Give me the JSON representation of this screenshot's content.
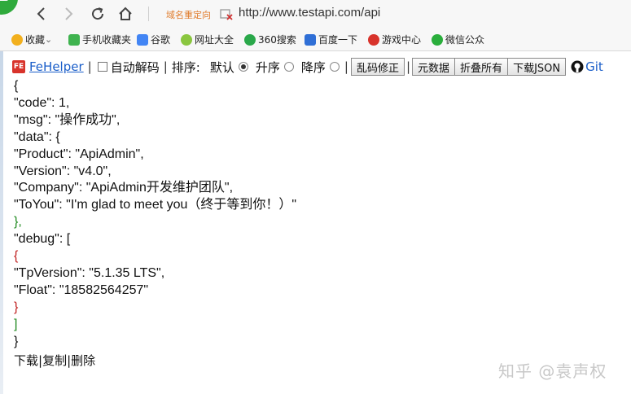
{
  "browser": {
    "redirect_label": "域名重定向",
    "url": "http://www.testapi.com/api"
  },
  "bookmarks": [
    {
      "label": "收藏",
      "icon": "star-icon",
      "color": "#f2b01e"
    },
    {
      "label": "手机收藏夹",
      "icon": "phone-icon",
      "color": "#3fb34f"
    },
    {
      "label": "谷歌",
      "icon": "google-icon",
      "color": "#4285f4"
    },
    {
      "label": "网址大全",
      "icon": "plus-circle-icon",
      "color": "#8ac63f"
    },
    {
      "label": "360搜索",
      "icon": "search-360-icon",
      "color": "#2aa84a"
    },
    {
      "label": "百度一下",
      "icon": "paw-icon",
      "color": "#2f6fd6"
    },
    {
      "label": "游戏中心",
      "icon": "game-icon",
      "color": "#d8332b"
    },
    {
      "label": "微信公众",
      "icon": "wechat-icon",
      "color": "#2aae3c"
    }
  ],
  "fehelper": {
    "logo": "FE",
    "name": "FeHelper",
    "auto_decode": "自动解码",
    "sort_label": "排序:",
    "sort_default": "默认",
    "sort_asc": "升序",
    "sort_desc": "降序",
    "btn_fix": "乱码修正",
    "btn_raw": "元数据",
    "btn_fold": "折叠所有",
    "btn_download": "下载JSON",
    "github": "Git"
  },
  "json_lines": [
    {
      "text": "{",
      "cls": "br-black"
    },
    {
      "text": "\"code\": 1,",
      "cls": ""
    },
    {
      "text": "\"msg\": \"操作成功\",",
      "cls": ""
    },
    {
      "text": "\"data\": {",
      "cls": ""
    },
    {
      "text": "\"Product\": \"ApiAdmin\",",
      "cls": ""
    },
    {
      "text": "\"Version\": \"v4.0\",",
      "cls": ""
    },
    {
      "text": "\"Company\": \"ApiAdmin开发维护团队\",",
      "cls": ""
    },
    {
      "text": "\"ToYou\": \"I'm glad to meet you（终于等到你！）\"",
      "cls": ""
    },
    {
      "text": "},",
      "cls": "br-green"
    },
    {
      "text": "\"debug\": [",
      "cls": ""
    },
    {
      "text": "{",
      "cls": "br-red"
    },
    {
      "text": "\"TpVersion\": \"5.1.35 LTS\",",
      "cls": ""
    },
    {
      "text": "\"Float\": \"18582564257\"",
      "cls": ""
    },
    {
      "text": "}",
      "cls": "br-red"
    },
    {
      "text": "]",
      "cls": "br-green"
    },
    {
      "text": "}",
      "cls": "br-black"
    }
  ],
  "actions": {
    "download": "下载",
    "copy": "复制",
    "delete": "删除",
    "sep": "|"
  },
  "watermark": "知乎 @袁声权"
}
